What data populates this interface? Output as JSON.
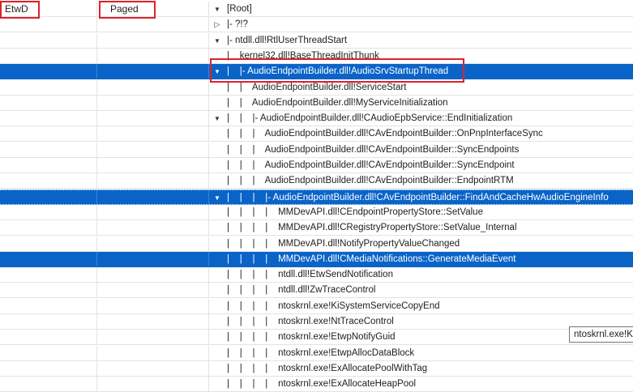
{
  "columns": {
    "etwd": "EtwD",
    "paged": "Paged"
  },
  "tree_rows": [
    {
      "text": "[Root]",
      "toggle": "expanded",
      "state": "normal"
    },
    {
      "text": "|- ?!?",
      "toggle": "collapsed",
      "state": "normal"
    },
    {
      "text": "|- ntdll.dll!RtlUserThreadStart",
      "toggle": "expanded",
      "state": "normal"
    },
    {
      "text": "|    kernel32.dll!BaseThreadInitThunk",
      "toggle": "none",
      "state": "normal"
    },
    {
      "text": "|    |- AudioEndpointBuilder.dll!AudioSrvStartupThread",
      "toggle": "expanded",
      "state": "selected"
    },
    {
      "text": "|    |    AudioEndpointBuilder.dll!ServiceStart",
      "toggle": "none",
      "state": "normal"
    },
    {
      "text": "|    |    AudioEndpointBuilder.dll!MyServiceInitialization",
      "toggle": "none",
      "state": "normal"
    },
    {
      "text": "|    |    |- AudioEndpointBuilder.dll!CAudioEpbService::EndInitialization",
      "toggle": "expanded",
      "state": "normal"
    },
    {
      "text": "|    |    |    AudioEndpointBuilder.dll!CAvEndpointBuilder::OnPnpInterfaceSync",
      "toggle": "none",
      "state": "normal"
    },
    {
      "text": "|    |    |    AudioEndpointBuilder.dll!CAvEndpointBuilder::SyncEndpoints",
      "toggle": "none",
      "state": "normal"
    },
    {
      "text": "|    |    |    AudioEndpointBuilder.dll!CAvEndpointBuilder::SyncEndpoint",
      "toggle": "none",
      "state": "normal"
    },
    {
      "text": "|    |    |    AudioEndpointBuilder.dll!CAvEndpointBuilder::EndpointRTM",
      "toggle": "none",
      "state": "normal"
    },
    {
      "text": "|    |    |    |- AudioEndpointBuilder.dll!CAvEndpointBuilder::FindAndCacheHwAudioEngineInfo",
      "toggle": "expanded",
      "state": "focused"
    },
    {
      "text": "|    |    |    |    MMDevAPI.dll!CEndpointPropertyStore::SetValue",
      "toggle": "none",
      "state": "normal"
    },
    {
      "text": "|    |    |    |    MMDevAPI.dll!CRegistryPropertyStore::SetValue_Internal",
      "toggle": "none",
      "state": "normal"
    },
    {
      "text": "|    |    |    |    MMDevAPI.dll!NotifyPropertyValueChanged",
      "toggle": "none",
      "state": "normal"
    },
    {
      "text": "|    |    |    |    MMDevAPI.dll!CMediaNotifications::GenerateMediaEvent",
      "toggle": "none",
      "state": "selected"
    },
    {
      "text": "|    |    |    |    ntdll.dll!EtwSendNotification",
      "toggle": "none",
      "state": "normal"
    },
    {
      "text": "|    |    |    |    ntdll.dll!ZwTraceControl",
      "toggle": "none",
      "state": "normal"
    },
    {
      "text": "|    |    |    |    ntoskrnl.exe!KiSystemServiceCopyEnd",
      "toggle": "none",
      "state": "normal"
    },
    {
      "text": "|    |    |    |    ntoskrnl.exe!NtTraceControl",
      "toggle": "none",
      "state": "normal"
    },
    {
      "text": "|    |    |    |    ntoskrnl.exe!EtwpNotifyGuid",
      "toggle": "none",
      "state": "normal"
    },
    {
      "text": "|    |    |    |    ntoskrnl.exe!EtwpAllocDataBlock",
      "toggle": "none",
      "state": "normal"
    },
    {
      "text": "|    |    |    |    ntoskrnl.exe!ExAllocatePoolWithTag",
      "toggle": "none",
      "state": "normal"
    },
    {
      "text": "|    |    |    |    ntoskrnl.exe!ExAllocateHeapPool",
      "toggle": "none",
      "state": "normal"
    }
  ],
  "tooltip": "ntoskrnl.exe!K"
}
